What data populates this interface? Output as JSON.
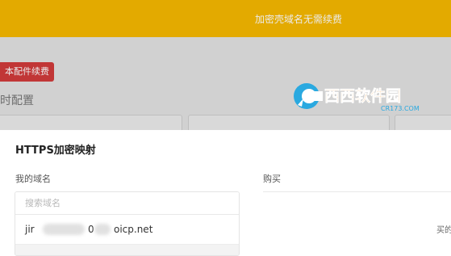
{
  "topbar": {
    "notice": "加密壳域名无需续费",
    "color": "#f7b900"
  },
  "background": {
    "renew_button_label": "本配件续费",
    "config_title": "时配置",
    "renew_button_color": "#d23b3b"
  },
  "modal": {
    "title": "HTTPS加密映射",
    "my_domains_label": "我的域名",
    "buy_label": "购买",
    "search_placeholder": "搜索域名",
    "domains": [
      {
        "visible_text": "jir   0   oicp.net",
        "prefix": "jir",
        "middle": "0",
        "suffix": "oicp.net"
      }
    ],
    "right_cut_text": "买的"
  },
  "watermark": {
    "brand_text": "西西软件园",
    "url_text": "CR173.COM"
  }
}
